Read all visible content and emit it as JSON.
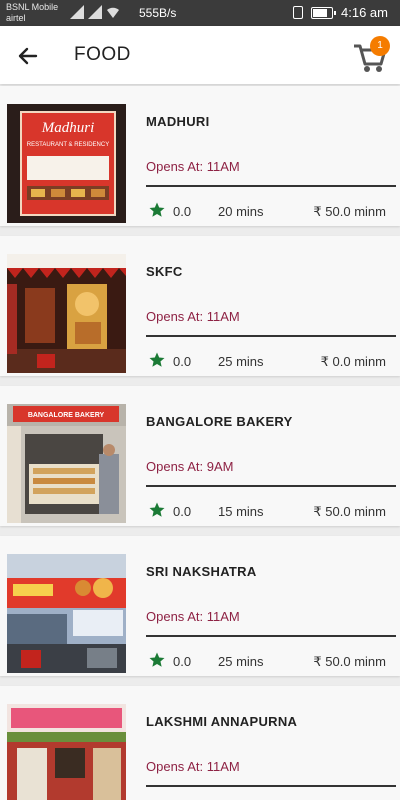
{
  "status_bar": {
    "carrier_1": "BSNL Mobile",
    "carrier_2": "airtel",
    "speed": "555B/s",
    "time": "4:16 am"
  },
  "header": {
    "title": "FOOD",
    "cart_count": "1"
  },
  "restaurants": [
    {
      "name": "MADHURI",
      "opens_label": "Opens At:",
      "opens_time": "11AM",
      "rating": "0.0",
      "time": "20 mins",
      "price": "₹ 50.0 minm"
    },
    {
      "name": "SKFC",
      "opens_label": "Opens At:",
      "opens_time": "11AM",
      "rating": "0.0",
      "time": "25 mins",
      "price": "₹ 0.0 minm"
    },
    {
      "name": "BANGALORE BAKERY",
      "opens_label": "Opens At:",
      "opens_time": "9AM",
      "rating": "0.0",
      "time": "15 mins",
      "price": "₹ 50.0 minm"
    },
    {
      "name": "SRI NAKSHATRA",
      "opens_label": "Opens At:",
      "opens_time": "11AM",
      "rating": "0.0",
      "time": "25 mins",
      "price": "₹ 50.0 minm"
    },
    {
      "name": "LAKSHMI ANNAPURNA",
      "opens_label": "Opens At:",
      "opens_time": "11AM",
      "rating": "",
      "time": "",
      "price": ""
    }
  ],
  "thumb_text": {
    "madhuri_logo": "Madhuri",
    "madhuri_sub": "RESTAURANT & RESIDENCY",
    "bakery_sign": "BANGALORE BAKERY"
  },
  "colors": {
    "accent": "#8e2244",
    "star": "#1b7a35",
    "badge": "#f57c00"
  }
}
